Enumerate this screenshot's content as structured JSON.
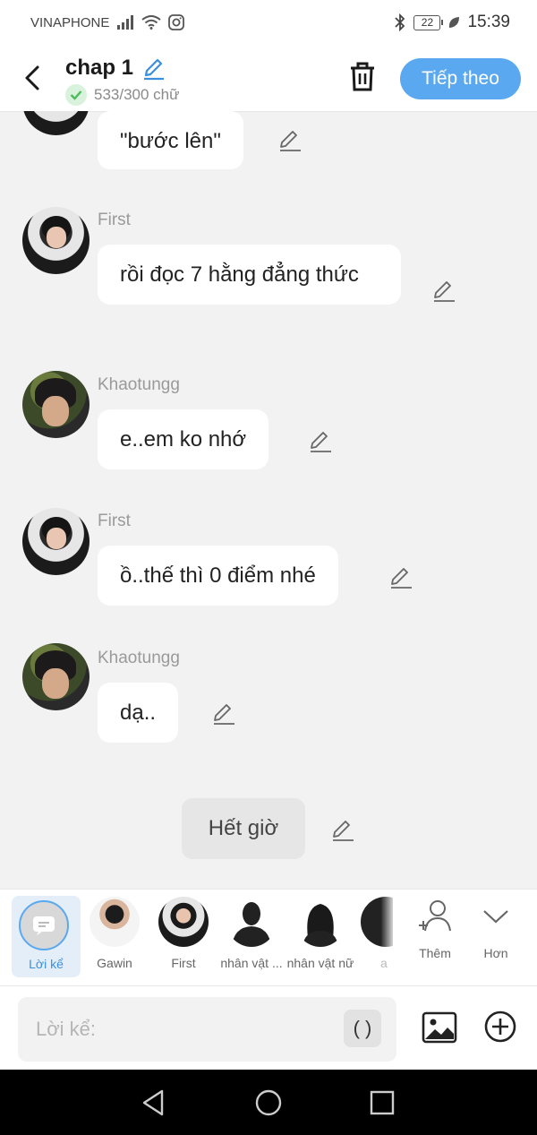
{
  "status_bar": {
    "carrier": "VINAPHONE",
    "battery": "22",
    "time": "15:39"
  },
  "header": {
    "title": "chap 1",
    "word_count": "533/300 chữ",
    "next_label": "Tiếp theo"
  },
  "messages": [
    {
      "sender": "",
      "text": "\"bước lên\"",
      "avatar": "first"
    },
    {
      "sender": "First",
      "text": "rồi đọc 7 hằng đẳng thức",
      "avatar": "first"
    },
    {
      "sender": "Khaotungg",
      "text": "e..em ko nhớ",
      "avatar": "khao"
    },
    {
      "sender": "First",
      "text": "ồ..thế thì 0 điểm nhé",
      "avatar": "first"
    },
    {
      "sender": "Khaotungg",
      "text": "dạ..",
      "avatar": "khao"
    }
  ],
  "narration_end": "Hết giờ",
  "characters": {
    "narration": "Lời kể",
    "items": [
      "Gawin",
      "First",
      "nhân vật ...",
      "nhân vật nữ",
      "a"
    ],
    "more_add": "Thêm",
    "more_toggle": "Hơn"
  },
  "input": {
    "placeholder": "Lời kể:",
    "paren_label": "( )"
  },
  "colors": {
    "accent": "#5aa9f0",
    "chat_background": "#f2f2f2",
    "check_green": "#4cbb5c"
  },
  "icons": [
    "back-arrow-icon",
    "pencil-icon",
    "check-icon",
    "trash-icon",
    "image-icon",
    "plus-circle-icon",
    "person-add-icon",
    "chevron-down-icon"
  ]
}
